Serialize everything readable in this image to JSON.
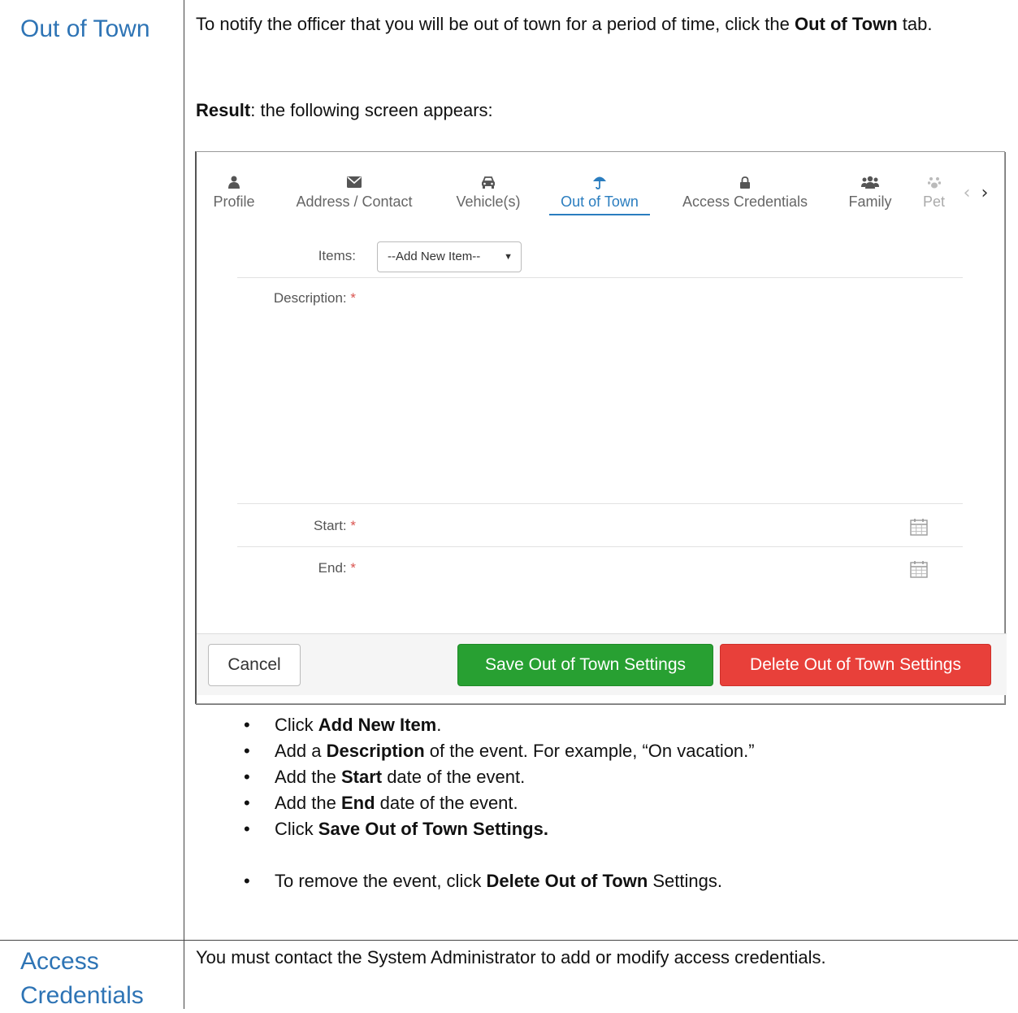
{
  "sections": [
    {
      "title": "Out of Town",
      "intro_pre": "To notify the officer that you will be out of town for a period of time, click the ",
      "intro_bold": "Out of Town",
      "intro_post": " tab.",
      "result_bold": "Result",
      "result_post": ": the following screen appears:",
      "bullets": [
        {
          "pre": "Click ",
          "bold": "Add New Item",
          "post": "."
        },
        {
          "pre": "Add a ",
          "bold": "Description",
          "post": " of the event. For example, “On vacation.”"
        },
        {
          "pre": "Add the ",
          "bold": "Start",
          "post": " date of the event."
        },
        {
          "pre": "Add the ",
          "bold": "End",
          "post": " date of the event."
        },
        {
          "pre": "Click ",
          "bold": "Save Out of Town Settings.",
          "post": ""
        },
        {
          "pre": "To remove the event, click ",
          "bold": "Delete Out of Town",
          "post": " Settings."
        }
      ]
    },
    {
      "title_line1": "Access",
      "title_line2": "Credentials",
      "body": "You must contact the System Administrator to add or modify access credentials."
    }
  ],
  "app": {
    "tabs": [
      {
        "label": "Profile",
        "icon": "user-icon",
        "active": false
      },
      {
        "label": "Address / Contact",
        "icon": "envelope-icon",
        "active": false
      },
      {
        "label": "Vehicle(s)",
        "icon": "car-icon",
        "active": false
      },
      {
        "label": "Out of Town",
        "icon": "umbrella-icon",
        "active": true
      },
      {
        "label": "Access Credentials",
        "icon": "lock-icon",
        "active": false
      },
      {
        "label": "Family",
        "icon": "users-icon",
        "active": false
      },
      {
        "label": "Pet",
        "icon": "paw-icon",
        "active": false
      }
    ],
    "nav": {
      "prev": "‹",
      "next": "›"
    },
    "form": {
      "items_label": "Items:",
      "items_value": "--Add New Item--",
      "description_label": "Description:",
      "start_label": "Start:",
      "end_label": "End:",
      "required_mark": "*"
    },
    "buttons": {
      "cancel": "Cancel",
      "save": "Save Out of Town Settings",
      "delete": "Delete Out of Town Settings"
    },
    "colors": {
      "accent": "#2a7dbf",
      "save": "#28a032",
      "delete": "#e8403a",
      "required": "#d9534f"
    }
  }
}
